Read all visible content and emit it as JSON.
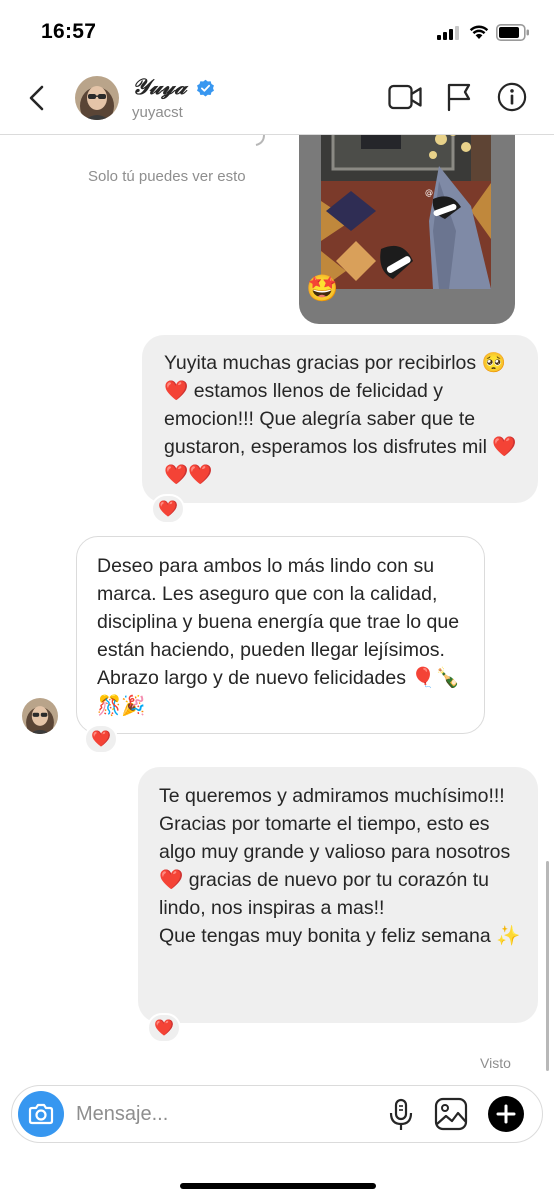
{
  "status_bar": {
    "time": "16:57"
  },
  "header": {
    "name": "𝒴𝓊𝓎𝒶",
    "handle": "yuyacst",
    "icons": [
      "back-arrow-icon",
      "verified-badge-icon",
      "video-call-icon",
      "flag-icon",
      "info-icon"
    ]
  },
  "thread": {
    "story_notice": "Solo tú puedes ver esto",
    "story_reaction": "🤩",
    "messages": [
      {
        "direction": "outgoing",
        "text": "Yuyita muchas gracias por recibirlos 🥺❤️ estamos llenos de felicidad y emocion!!! Que alegría saber que te gustaron, esperamos los disfrutes mil ❤️❤️❤️",
        "reaction": "❤️"
      },
      {
        "direction": "incoming",
        "text": "Deseo para ambos lo más lindo con su marca.  Les aseguro que con la calidad, disciplina y buena energía que trae lo que están haciendo, pueden llegar lejísimos.  Abrazo largo y de nuevo felicidades 🎈🍾🎊🎉",
        "reaction": "❤️"
      },
      {
        "direction": "outgoing",
        "text": "Te queremos y admiramos muchísimo!!!  Gracias por tomarte el tiempo, esto es algo muy grande y valioso para nosotros❤️ gracias de nuevo por tu corazón tu lindo, nos inspiras a mas!!\nQue tengas muy bonita y feliz semana ✨",
        "reaction": "❤️"
      }
    ],
    "seen_label": "Visto"
  },
  "composer": {
    "placeholder": "Mensaje...",
    "icons": [
      "camera-icon",
      "microphone-icon",
      "gallery-icon",
      "plus-icon"
    ]
  },
  "colors": {
    "accent": "#3797f0",
    "bubble_gray": "#efefef",
    "secondary_text": "#8e8e8e",
    "heart_red": "#ed4956"
  }
}
